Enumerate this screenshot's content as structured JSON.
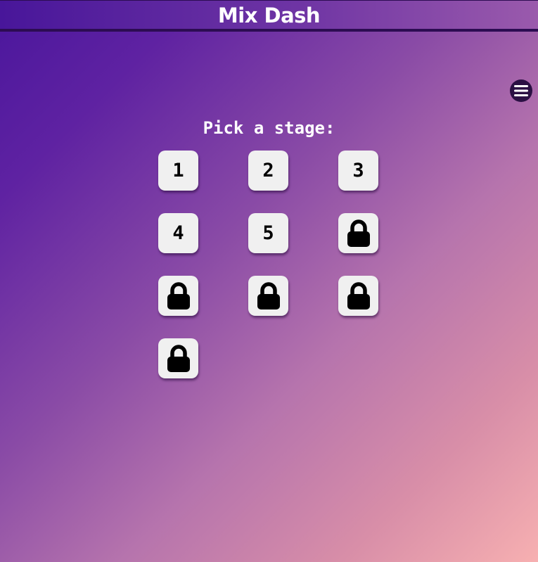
{
  "header": {
    "title": "Mix Dash"
  },
  "menu": {
    "icon": "hamburger-menu-icon"
  },
  "stage_select": {
    "prompt": "Pick a stage:",
    "stages": [
      {
        "label": "1",
        "locked": false
      },
      {
        "label": "2",
        "locked": false
      },
      {
        "label": "3",
        "locked": false
      },
      {
        "label": "4",
        "locked": false
      },
      {
        "label": "5",
        "locked": false
      },
      {
        "label": "",
        "locked": true,
        "icon": "lock-icon"
      },
      {
        "label": "",
        "locked": true,
        "icon": "lock-icon"
      },
      {
        "label": "",
        "locked": true,
        "icon": "lock-icon"
      },
      {
        "label": "",
        "locked": true,
        "icon": "lock-icon"
      },
      {
        "label": "",
        "locked": true,
        "icon": "lock-icon"
      }
    ]
  },
  "colors": {
    "gradient_start": "#4a169c",
    "gradient_end": "#f7b0b1",
    "header_border": "#2c0c52",
    "tile_bg": "#f0f0f0",
    "menu_bg": "#2b1044"
  }
}
